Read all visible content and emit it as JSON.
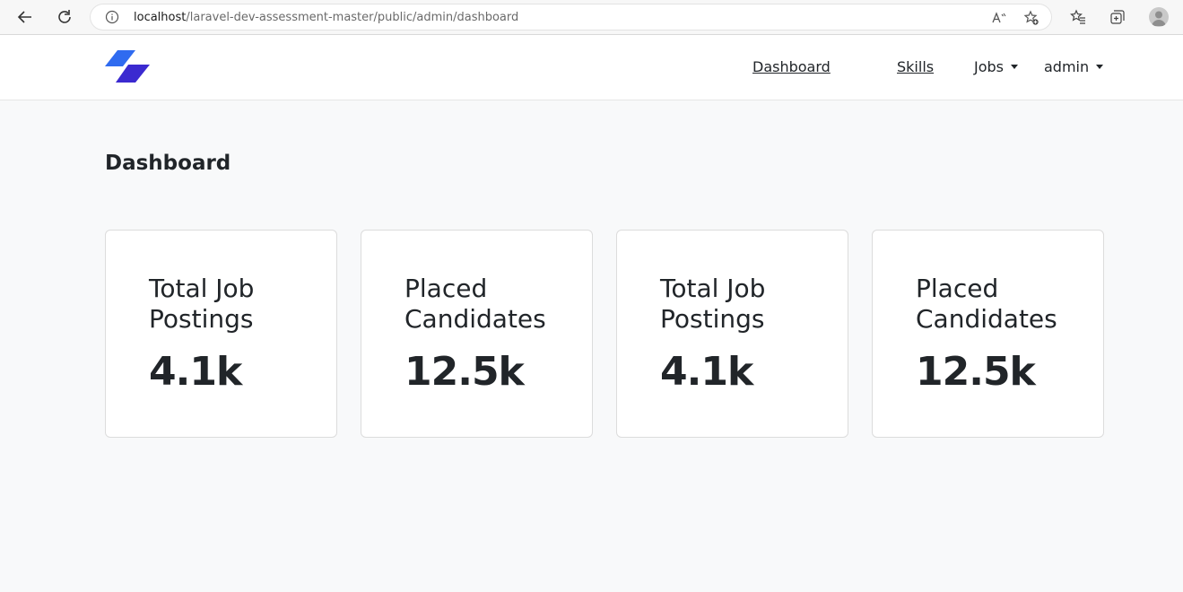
{
  "browser": {
    "url_host": "localhost",
    "url_path": "/laravel-dev-assessment-master/public/admin/dashboard"
  },
  "navbar": {
    "links": [
      {
        "label": "Dashboard"
      },
      {
        "label": "Skills"
      },
      {
        "label": "Jobs"
      },
      {
        "label": "admin"
      }
    ]
  },
  "page": {
    "title": "Dashboard"
  },
  "cards": [
    {
      "label": "Total Job Postings",
      "value": "4.1k"
    },
    {
      "label": "Placed Candidates",
      "value": "12.5k"
    },
    {
      "label": "Total Job Postings",
      "value": "4.1k"
    },
    {
      "label": "Placed Candidates",
      "value": "12.5k"
    }
  ],
  "colors": {
    "logo_light": "#2f6bf0",
    "logo_dark": "#3b2ad0",
    "background": "#f8f9fa"
  }
}
